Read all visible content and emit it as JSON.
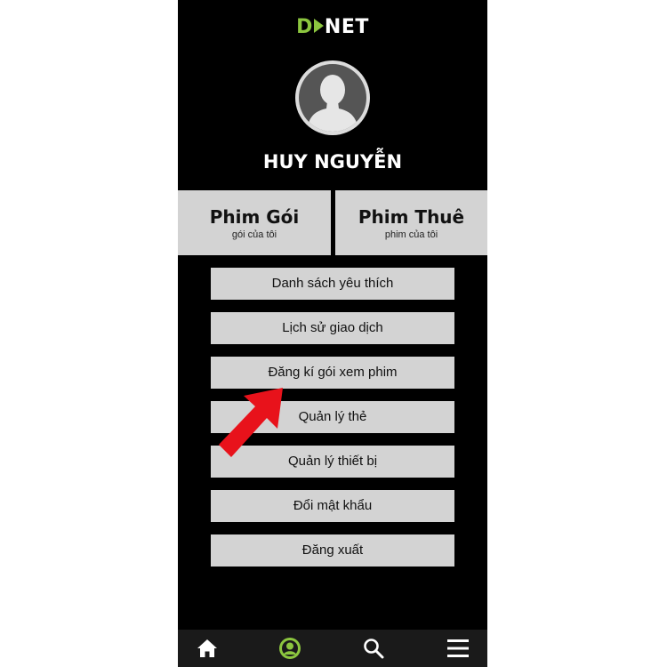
{
  "app": {
    "logo_highlight": "D",
    "logo_rest": "NET",
    "brand_color": "#8cc63f"
  },
  "profile": {
    "name": "HUY NGUYỄN",
    "avatar_icon": "user-silhouette-icon"
  },
  "tabs": [
    {
      "title": "Phim Gói",
      "subtitle": "gói của tôi"
    },
    {
      "title": "Phim Thuê",
      "subtitle": "phim của tôi"
    }
  ],
  "menu": {
    "items": [
      {
        "label": "Danh sách yêu thích"
      },
      {
        "label": "Lịch sử giao dịch"
      },
      {
        "label": "Đăng kí gói xem phim"
      },
      {
        "label": "Quản lý thẻ"
      },
      {
        "label": "Quản lý thiết bị"
      },
      {
        "label": "Đổi mật khẩu"
      },
      {
        "label": "Đăng xuất"
      }
    ]
  },
  "annotation": {
    "icon": "red-pointer-arrow-icon",
    "color": "#e8121b"
  },
  "bottom_nav": {
    "items": [
      {
        "icon": "home-icon"
      },
      {
        "icon": "profile-icon",
        "active_color": "#8cc63f"
      },
      {
        "icon": "search-icon"
      },
      {
        "icon": "menu-icon"
      }
    ]
  }
}
